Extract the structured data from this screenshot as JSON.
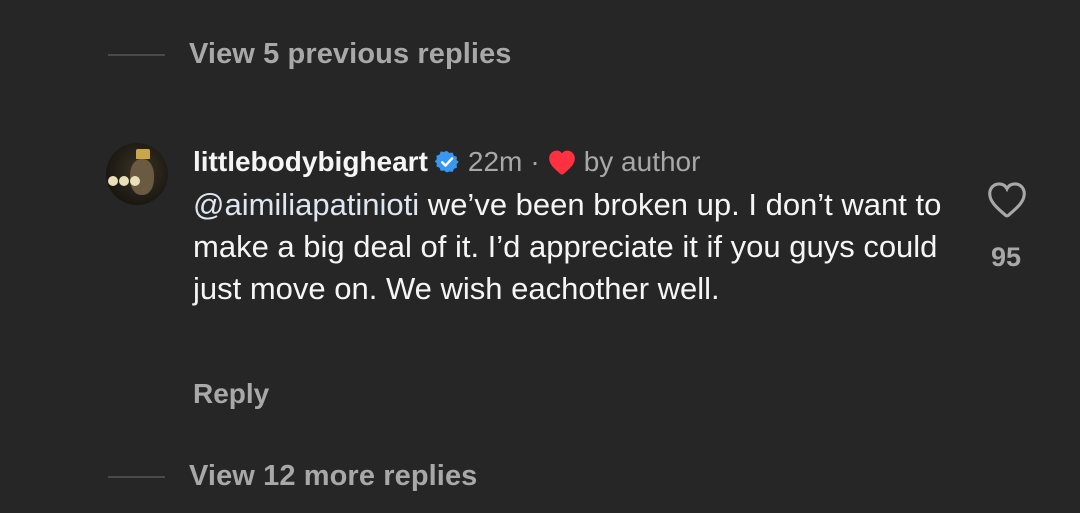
{
  "thread": {
    "view_previous": "View 5 previous replies",
    "view_more": "View 12 more replies"
  },
  "comment": {
    "username": "littlebodybigheart",
    "time": "22m",
    "separator": "·",
    "liked_by": "by author",
    "mention": "@aimiliapatinioti",
    "text": " we’ve been broken up. I don’t want to make a big deal of it. I’d appreciate it if you guys could just move on. We wish eachother well.",
    "reply_label": "Reply",
    "like_count": "95"
  },
  "icons": {
    "verified": "verified-badge-icon",
    "author_heart": "heart-filled-icon",
    "like": "heart-outline-icon"
  },
  "colors": {
    "background": "#262626",
    "primary_text": "#f5f5f5",
    "secondary_text": "#a8a8a8",
    "verified_blue": "#3897f0",
    "heart_red": "#ff3040"
  }
}
